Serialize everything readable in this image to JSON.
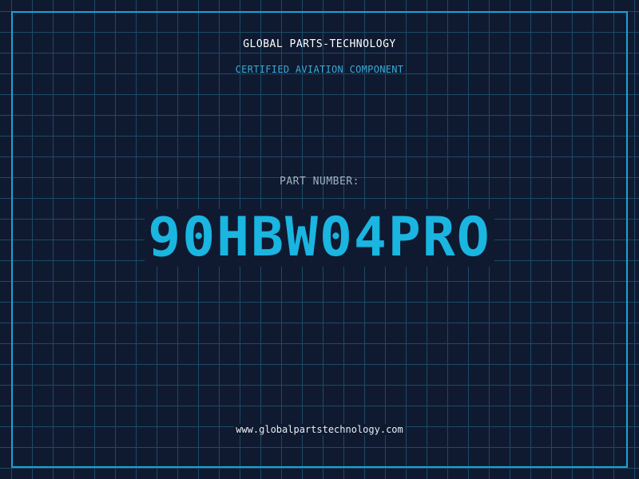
{
  "header": {
    "company": "GLOBAL PARTS-TECHNOLOGY",
    "subtitle": "CERTIFIED AVIATION COMPONENT"
  },
  "part": {
    "label": "PART NUMBER:",
    "number": "90HBW04PRO"
  },
  "footer": {
    "url": "www.globalpartstechnology.com"
  },
  "colors": {
    "background": "#0f1a30",
    "grid": "#1c4a66",
    "frame": "#1aa3d0",
    "accent": "#1ab5e0"
  }
}
